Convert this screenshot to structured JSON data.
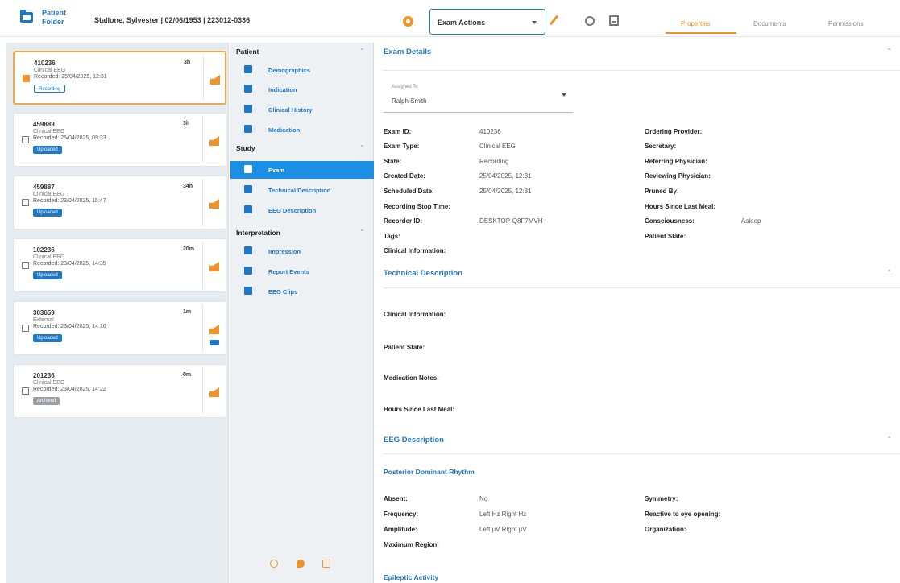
{
  "header": {
    "folder_title": "Patient Folder",
    "patient_info": "Stallone, Sylvester  |  02/06/1953  |  223012-0336",
    "exam_actions_label": "Exam Actions",
    "tabs": [
      "Properties",
      "Documents",
      "Permissions"
    ],
    "accent_color": "#f0932b",
    "primary_color": "#1f77c8"
  },
  "exams": [
    {
      "id": "410236",
      "duration": "3h",
      "type": "Clinical EEG",
      "recorded": "Recorded: 25/04/2025, 12:31",
      "status": "Recording"
    },
    {
      "id": "459889",
      "duration": "3h",
      "type": "Clinical EEG",
      "recorded": "Recorded: 25/04/2025, 09:33",
      "status": "Uploaded"
    },
    {
      "id": "459887",
      "duration": "34h",
      "type": "Clinical EEG",
      "recorded": "Recorded: 23/04/2025, 15:47",
      "status": "Uploaded"
    },
    {
      "id": "102236",
      "duration": "20m",
      "type": "Clinical EEG",
      "recorded": "Recorded: 23/04/2025, 14:35",
      "status": "Uploaded"
    },
    {
      "id": "303659",
      "duration": "1m",
      "type": "External",
      "recorded": "Recorded: 23/04/2025, 14:16",
      "status": "Uploaded"
    },
    {
      "id": "201236",
      "duration": "8m",
      "type": "Clinical EEG",
      "recorded": "Recorded: 23/04/2025, 14:22",
      "status": "Archived"
    }
  ],
  "nav": {
    "patient_section": "Patient",
    "patient_items": [
      "Demographics",
      "Indication",
      "Clinical History",
      "Medication"
    ],
    "study_section": "Study",
    "study_items": [
      "Exam",
      "Technical Description",
      "EEG Description"
    ],
    "interpretation_section": "Interpretation",
    "interpretation_items": [
      "Impression",
      "Report Events",
      "EEG Clips"
    ]
  },
  "exam_details": {
    "title": "Exam Details",
    "assigned_caption": "Assigned To",
    "assigned_value": "Ralph Smith",
    "left_fields": [
      {
        "label": "Exam ID:",
        "value": "410236"
      },
      {
        "label": "Exam Type:",
        "value": "Clinical EEG"
      },
      {
        "label": "State:",
        "value": "Recording"
      },
      {
        "label": "Created Date:",
        "value": "25/04/2025, 12:31"
      },
      {
        "label": "Scheduled Date:",
        "value": "25/04/2025, 12:31"
      },
      {
        "label": "Recording Stop Time:",
        "value": ""
      },
      {
        "label": "Recorder ID:",
        "value": "DESKTOP-Q8F7MVH"
      },
      {
        "label": "Tags:",
        "value": ""
      },
      {
        "label": "Clinical Information:",
        "value": ""
      }
    ],
    "right_fields": [
      {
        "label": "Ordering Provider:",
        "value": ""
      },
      {
        "label": "Secretary:",
        "value": ""
      },
      {
        "label": "Referring Physician:",
        "value": ""
      },
      {
        "label": "Reviewing Physician:",
        "value": ""
      },
      {
        "label": "Pruned By:",
        "value": ""
      },
      {
        "label": "Hours Since Last Meal:",
        "value": ""
      },
      {
        "label": "Consciousness:",
        "value": "Asleep"
      },
      {
        "label": "Patient State:",
        "value": ""
      }
    ]
  },
  "technical_description": {
    "title": "Technical Description",
    "fields": [
      "Clinical Information:",
      "Patient State:",
      "Medication Notes:",
      "Hours Since Last Meal:"
    ]
  },
  "eeg_description": {
    "title": "EEG Description",
    "subtitle": "Posterior Dominant Rhythm",
    "left_fields": [
      {
        "label": "Absent:",
        "value": "No"
      },
      {
        "label": "Frequency:",
        "value": "Left Hz Right Hz"
      },
      {
        "label": "Amplitude:",
        "value": "Left µV Right µV"
      },
      {
        "label": "Maximum Region:",
        "value": ""
      }
    ],
    "right_fields": [
      "Symmetry:",
      "Reactive to eye opening:",
      "Organization:"
    ],
    "next_subtitle": "Epileptic Activity"
  }
}
